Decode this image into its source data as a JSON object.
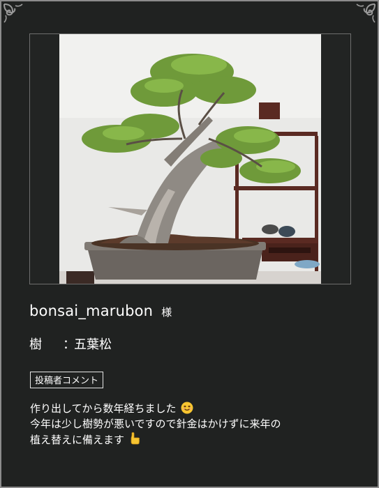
{
  "post": {
    "username": "bonsai_marubon",
    "honorific": "様",
    "tree_label": "樹",
    "tree_separator": "：",
    "tree_value": "五葉松",
    "comment_heading": "投稿者コメント",
    "comment_lines": [
      "作り出してから数年経ちました",
      "今年は少し樹勢が悪いですので針金はかけずに来年の",
      "植え替えに備えます"
    ]
  },
  "icons": {
    "line1_emoji": "smiling-face-emoji",
    "line3_emoji": "thumbs-up-emoji"
  },
  "colors": {
    "card_bg": "#202221",
    "border": "#8c8c8c",
    "text": "#ffffff"
  }
}
